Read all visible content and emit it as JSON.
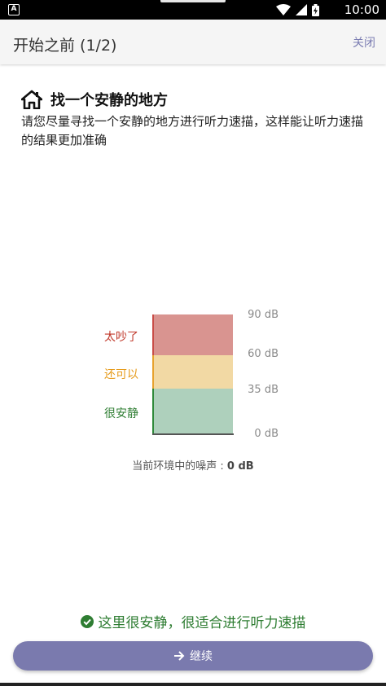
{
  "status_bar": {
    "notification_letter": "A",
    "time": "10:00",
    "icons": [
      "wifi-icon",
      "signal-icon",
      "battery-icon"
    ]
  },
  "header": {
    "title": "开始之前 (1/2)",
    "close_label": "关闭"
  },
  "section": {
    "icon": "home-icon",
    "title": "找一个安静的地方",
    "description": "请您尽量寻找一个安静的地方进行听力速描，这样能让听力速描的结果更加准确"
  },
  "meter": {
    "levels": [
      {
        "label": "太吵了",
        "color": "#c0392b"
      },
      {
        "label": "还可以",
        "color": "#e69a19"
      },
      {
        "label": "很安静",
        "color": "#2e7d32"
      }
    ],
    "ticks": [
      "90 dB",
      "60 dB",
      "35 dB",
      "0 dB"
    ],
    "band_colors": {
      "loud": "#d99490",
      "ok": "#f2d9a4",
      "quiet": "#aed0bc"
    }
  },
  "noise": {
    "prefix": "当前环境中的噪声 : ",
    "value": "0 dB"
  },
  "result": {
    "icon": "check-circle-icon",
    "text": "这里很安静，很适合进行听力速描",
    "color": "#2e7d32"
  },
  "continue_button": {
    "icon": "arrow-right-icon",
    "label": "继续",
    "color": "#7a7aae"
  }
}
